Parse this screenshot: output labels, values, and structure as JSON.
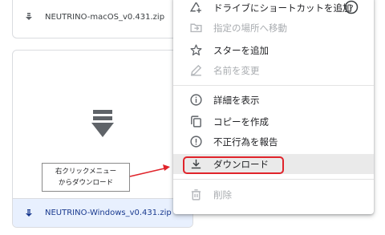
{
  "files": [
    {
      "name": "NEUTRINO-macOS_v0.431.zip",
      "selected": false
    },
    {
      "name": "NEUTRINO-Windows_v0.431.zip",
      "selected": true
    }
  ],
  "context_menu": {
    "items": [
      {
        "label": "ドライブにショートカットを追加",
        "icon": "add-shortcut-icon",
        "disabled": false,
        "help": true
      },
      {
        "label": "指定の場所へ移動",
        "icon": "move-to-icon",
        "disabled": true
      },
      {
        "label": "スターを追加",
        "icon": "star-icon",
        "disabled": false
      },
      {
        "label": "名前を変更",
        "icon": "pencil-icon",
        "disabled": true
      },
      {
        "label": "詳細を表示",
        "icon": "info-icon",
        "disabled": false
      },
      {
        "label": "コピーを作成",
        "icon": "copy-icon",
        "disabled": false
      },
      {
        "label": "不正行為を報告",
        "icon": "report-icon",
        "disabled": false
      },
      {
        "label": "ダウンロード",
        "icon": "download-icon",
        "disabled": false,
        "hovered": true
      },
      {
        "label": "削除",
        "icon": "trash-icon",
        "disabled": true
      }
    ],
    "help_icon": "help-circle-icon"
  },
  "annotation": {
    "line1": "右クリックメニュー",
    "line2": "からダウンロード",
    "color": "#e0242b"
  },
  "colors": {
    "selected_bg": "#e8f0fe",
    "disabled_text": "#a9acb0",
    "hover_bg": "#eaeaea"
  }
}
